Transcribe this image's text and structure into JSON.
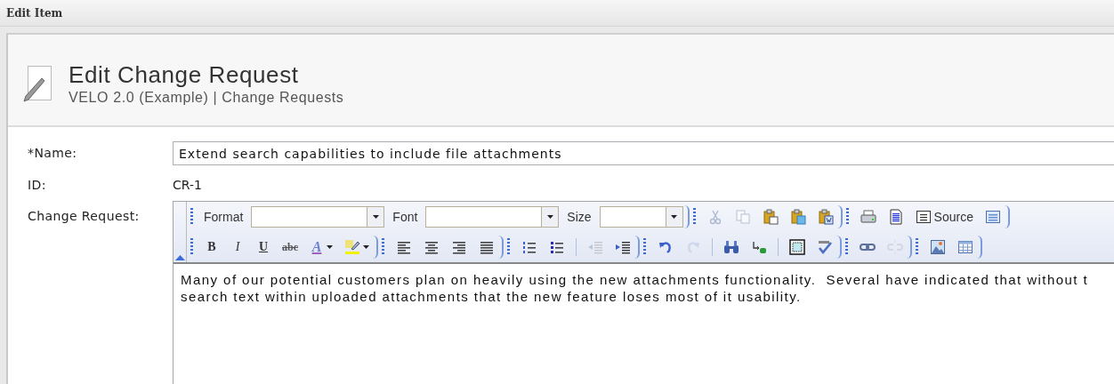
{
  "window": {
    "title": "Edit Item"
  },
  "header": {
    "title": "Edit Change Request",
    "subtitle": "VELO 2.0 (Example) | Change Requests"
  },
  "fields": [
    {
      "kind": "input",
      "label": "*Name:",
      "value": "Extend search capabilities to include file attachments"
    },
    {
      "kind": "text",
      "label": "ID:",
      "value": "CR-1"
    },
    {
      "kind": "editor",
      "label": "Change Request:"
    }
  ],
  "toolbar": {
    "rows": [
      {
        "groups": [
          {
            "items": [
              {
                "kind": "label",
                "text": "Format"
              },
              {
                "kind": "combo"
              },
              {
                "kind": "label",
                "text": "Font"
              },
              {
                "kind": "combo"
              },
              {
                "kind": "label",
                "text": "Size"
              },
              {
                "kind": "combo"
              }
            ]
          },
          {
            "items": [
              {
                "kind": "cut",
                "disabled": true
              },
              {
                "kind": "copy",
                "disabled": true
              },
              {
                "kind": "paste",
                "disabled": false
              },
              {
                "kind": "paste-text",
                "disabled": false
              },
              {
                "kind": "paste-word",
                "disabled": false
              }
            ]
          },
          {
            "items": [
              {
                "kind": "print",
                "disabled": false
              },
              {
                "kind": "preview",
                "disabled": false
              },
              {
                "kind": "source",
                "text": "Source",
                "disabled": false
              },
              {
                "kind": "maximize",
                "disabled": false
              }
            ]
          }
        ]
      },
      {
        "groups": [
          {
            "items": [
              {
                "kind": "bold",
                "text": "B",
                "disabled": false
              },
              {
                "kind": "italic",
                "text": "I",
                "disabled": false
              },
              {
                "kind": "underline",
                "text": "U",
                "disabled": false
              },
              {
                "kind": "strike",
                "text": "abc",
                "disabled": false
              },
              {
                "kind": "text-color",
                "text": "A",
                "disabled": false
              },
              {
                "kind": "highlight",
                "disabled": false
              }
            ]
          },
          {
            "items": [
              {
                "kind": "align-left",
                "disabled": false
              },
              {
                "kind": "align-center",
                "disabled": false
              },
              {
                "kind": "align-right",
                "disabled": false
              },
              {
                "kind": "justify",
                "disabled": false
              }
            ]
          },
          {
            "items": [
              {
                "kind": "ordered-list",
                "disabled": false
              },
              {
                "kind": "bullet-list",
                "disabled": false
              },
              {
                "kind": "separator"
              },
              {
                "kind": "outdent",
                "disabled": true
              },
              {
                "kind": "indent",
                "disabled": false
              }
            ]
          },
          {
            "items": [
              {
                "kind": "undo",
                "disabled": false
              },
              {
                "kind": "redo",
                "disabled": true
              },
              {
                "kind": "separator"
              },
              {
                "kind": "find",
                "disabled": false
              },
              {
                "kind": "replace",
                "disabled": false
              },
              {
                "kind": "separator"
              },
              {
                "kind": "select-all",
                "disabled": false
              },
              {
                "kind": "spellcheck",
                "disabled": false
              }
            ]
          },
          {
            "items": [
              {
                "kind": "link",
                "disabled": false
              },
              {
                "kind": "unlink",
                "disabled": true
              }
            ]
          },
          {
            "items": [
              {
                "kind": "image",
                "disabled": false
              },
              {
                "kind": "table",
                "disabled": false
              }
            ]
          }
        ]
      }
    ]
  },
  "editor": {
    "lines": [
      "Many of our potential customers plan on heavily using the new attachments functionality.  Several have indicated that without t",
      "search text within uploaded attachments that the new feature loses most of it usability."
    ]
  }
}
